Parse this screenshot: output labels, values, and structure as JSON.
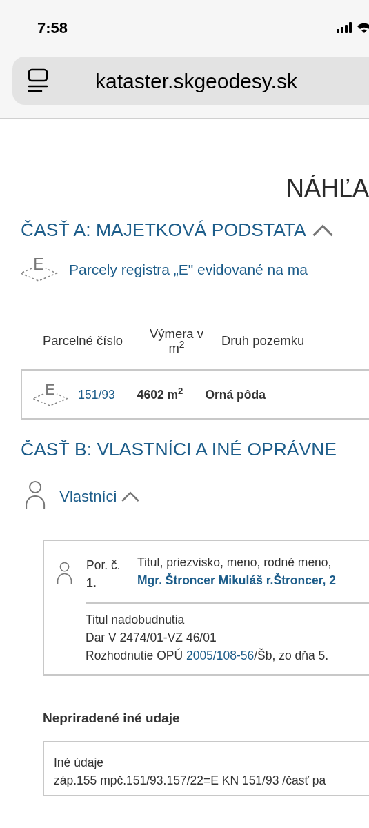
{
  "status_bar": {
    "time": "7:58"
  },
  "browser": {
    "url": "kataster.skgeodesy.sk"
  },
  "page_title": "NÁHĽA",
  "part_a": {
    "title": "ČASŤ A: MAJETKOVÁ PODSTATA",
    "expanded": true,
    "register_letter": "E",
    "register_heading": "Parcely registra „E\" evidované na ma",
    "table": {
      "columns": [
        "Parcelné číslo",
        "Výmera v m$^{2}$",
        "Druh pozemku"
      ],
      "rows": [
        {
          "register_letter": "E",
          "parcel_number": "151/93",
          "area": "4602 m$^{2}$",
          "land_type": "Orná pôda"
        }
      ]
    }
  },
  "part_b": {
    "title": "ČASŤ B: VLASTNÍCI A INÉ OPRÁVNE",
    "owners": {
      "title": "Vlastníci",
      "expanded": true,
      "entries": [
        {
          "order_label": "Por. č.",
          "order": "1.",
          "name_label": "Titul, priezvisko, meno, rodné meno,",
          "name": "Mgr. Štroncer Mikuláš r.Štroncer, 2",
          "acquisition_label": "Titul nadobudnutia",
          "acquisition_lines": [
            {
              "text_before": "Dar V 2474/01-VZ 46/01"
            },
            {
              "text_before": "Rozhodnutie OPÚ ",
              "link": "2005/108-56",
              "text_after": "/Šb, zo dňa 5."
            }
          ]
        }
      ]
    },
    "unassigned": {
      "title": "Nepriradené iné udaje",
      "label": "Iné údaje",
      "text": "záp.155 mpč.151/93.157/22=E KN 151/93 /časť pa"
    }
  }
}
